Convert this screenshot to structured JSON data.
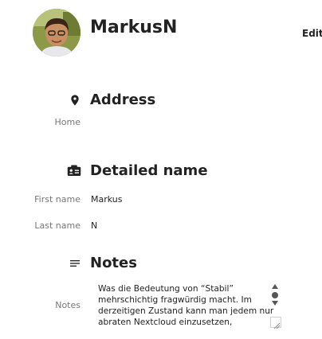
{
  "contact": {
    "name": "MarkusN",
    "edit_label": "Edit"
  },
  "sections": {
    "address": {
      "title": "Address",
      "icon": "map-marker-icon",
      "fields": [
        {
          "label": "Home",
          "value": ""
        }
      ]
    },
    "detailed_name": {
      "title": "Detailed name",
      "icon": "id-card-icon",
      "fields": [
        {
          "label": "First name",
          "value": "Markus"
        },
        {
          "label": "Last name",
          "value": "N"
        }
      ]
    },
    "notes": {
      "title": "Notes",
      "icon": "text-lines-icon",
      "label": "Notes",
      "value": "Was die Bedeutung von “Stabil” mehrschichtig fragwürdig macht. Im derzeitigen Zustand kann man jedem nur abraten Nextcloud einzusetzen,"
    }
  },
  "colors": {
    "text": "#222222",
    "label": "#767676",
    "background": "#ffffff"
  }
}
